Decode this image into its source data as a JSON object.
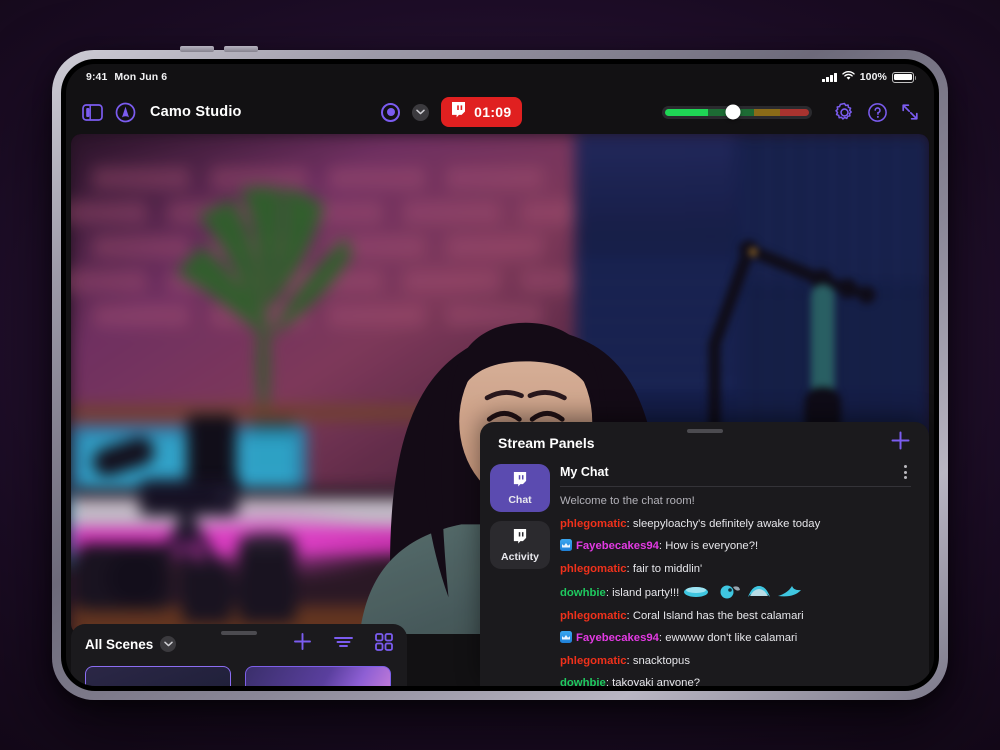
{
  "statusbar": {
    "time": "9:41",
    "date": "Mon Jun 6",
    "battery_percent": "100%",
    "icons": {
      "cellular": "cellular-signal-icon",
      "wifi": "wifi-icon",
      "battery": "battery-icon"
    }
  },
  "toolbar": {
    "sidebar_toggle_icon": "sidebar-toggle-icon",
    "app_logo_icon": "camo-logo-icon",
    "title": "Camo Studio",
    "record_button_icon": "record-button-icon",
    "record_options_icon": "chevron-down-icon",
    "live": {
      "platform_icon": "twitch-icon",
      "timer": "01:09",
      "color": "#e02020"
    },
    "audio_meter": {
      "name": "audio-level-meter",
      "value_percent": 47,
      "segments": [
        {
          "color": "#1fd655",
          "width_percent": 30
        },
        {
          "color": "#1d6b34",
          "width_percent": 18
        },
        {
          "color": "#1d6b34",
          "width_percent": 14
        },
        {
          "color": "#8a6b18",
          "width_percent": 18
        },
        {
          "color": "#a8332f",
          "width_percent": 20
        }
      ]
    },
    "settings_icon": "gear-icon",
    "help_icon": "help-icon",
    "expand_icon": "expand-diagonal-icon",
    "accent_color": "#7b5cf0"
  },
  "video_preview": {
    "name": "camera-preview",
    "description": "Streamer at desk with brick wall, plant, camera gear, magenta LED lighting, mic boom arm and tablet"
  },
  "scenes": {
    "title": "All Scenes",
    "chevron_icon": "chevron-down-icon",
    "add_icon": "plus-icon",
    "list_icon": "list-view-icon",
    "grid_icon": "grid-view-icon",
    "thumbnails": [
      {
        "name": "scene-thumbnail-1",
        "selected": true
      },
      {
        "name": "scene-thumbnail-2",
        "selected": false
      }
    ]
  },
  "stream_panels": {
    "title": "Stream Panels",
    "add_icon": "plus-icon",
    "tabs": [
      {
        "label": "Chat",
        "icon": "twitch-icon",
        "active": true
      },
      {
        "label": "Activity",
        "icon": "twitch-icon",
        "active": false
      }
    ],
    "chat": {
      "title": "My Chat",
      "menu_icon": "more-vertical-icon",
      "messages": [
        {
          "type": "system",
          "text": "Welcome to the chat room!"
        },
        {
          "type": "message",
          "user": "phlegomatic",
          "color": "#f0311b",
          "badge": false,
          "text": "sleepyloachy's definitely awake today"
        },
        {
          "type": "message",
          "user": "Fayebecakes94",
          "color": "#e23ae2",
          "badge": true,
          "text": "How is everyone?!"
        },
        {
          "type": "message",
          "user": "phlegomatic",
          "color": "#f0311b",
          "badge": false,
          "text": "fair to middlin'"
        },
        {
          "type": "message",
          "user": "dowhbie",
          "color": "#1ec95f",
          "badge": false,
          "text": "island party!!!",
          "emotes": 4
        },
        {
          "type": "message",
          "user": "phlegomatic",
          "color": "#f0311b",
          "badge": false,
          "text": "Coral Island has the best calamari"
        },
        {
          "type": "message",
          "user": "Fayebecakes94",
          "color": "#e23ae2",
          "badge": true,
          "text": "ewwww don't like calamari"
        },
        {
          "type": "message",
          "user": "phlegomatic",
          "color": "#f0311b",
          "badge": false,
          "text": "snacktopus"
        },
        {
          "type": "message",
          "user": "dowhbie",
          "color": "#1ec95f",
          "badge": false,
          "text": "takoyaki anyone?"
        }
      ]
    }
  }
}
